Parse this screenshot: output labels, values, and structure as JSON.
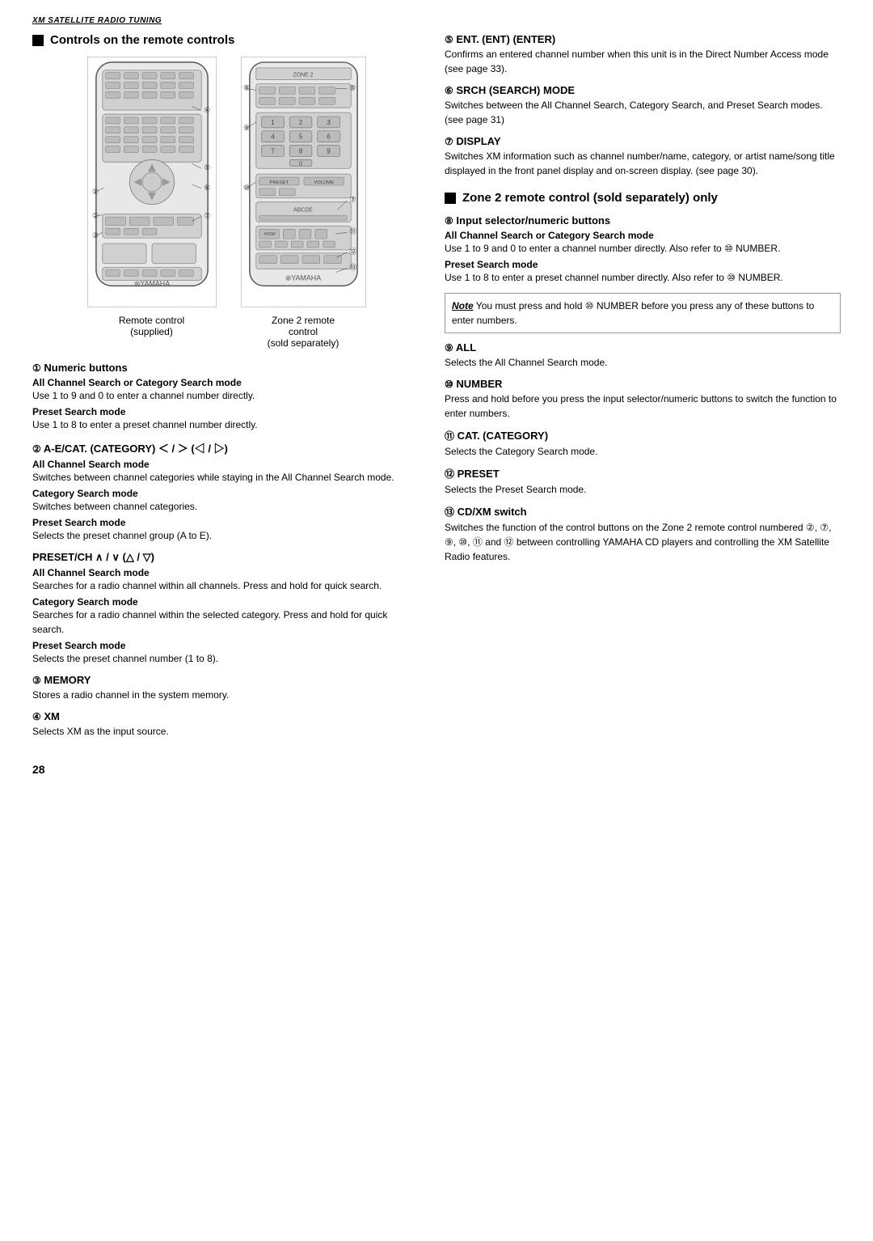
{
  "header": {
    "label": "XM SATELLITE RADIO TUNING"
  },
  "left_section": {
    "title": "Controls on the remote controls",
    "remote1_label": "Remote control\n(supplied)",
    "remote2_label": "Zone 2 remote\ncontrol\n(sold separately)",
    "items": [
      {
        "num": "①",
        "title": "Numeric buttons",
        "subs": [
          {
            "subtitle": "All Channel Search or Category Search mode",
            "text": "Use 1 to 9 and 0 to enter a channel number directly."
          },
          {
            "subtitle": "Preset Search mode",
            "text": "Use 1 to 8 to enter a preset channel number directly."
          }
        ]
      },
      {
        "num": "②",
        "title": "A-E/CAT. (CATEGORY) ＜ / ＞ (◁ / ▷)",
        "subs": [
          {
            "subtitle": "All Channel Search mode",
            "text": "Switches between channel categories while staying in the All Channel Search mode."
          },
          {
            "subtitle": "Category Search mode",
            "text": "Switches between channel categories."
          },
          {
            "subtitle": "Preset Search mode",
            "text": "Selects the preset channel group (A to E)."
          }
        ]
      },
      {
        "num": "",
        "title": "PRESET/CH ∧ / ∨ (△ / ▽)",
        "subs": [
          {
            "subtitle": "All Channel Search mode",
            "text": "Searches for a radio channel within all channels. Press and hold for quick search."
          },
          {
            "subtitle": "Category Search mode",
            "text": "Searches for a radio channel within the selected category. Press and hold for quick search."
          },
          {
            "subtitle": "Preset Search mode",
            "text": "Selects the preset channel number (1 to 8)."
          }
        ]
      },
      {
        "num": "③",
        "title": "MEMORY",
        "subs": [
          {
            "subtitle": "",
            "text": "Stores a radio channel in the system memory."
          }
        ]
      },
      {
        "num": "④",
        "title": "XM",
        "subs": [
          {
            "subtitle": "",
            "text": "Selects XM as the input source."
          }
        ]
      }
    ]
  },
  "right_section": {
    "items": [
      {
        "num": "⑤",
        "title": "ENT. (ENT) (ENTER)",
        "text": "Confirms an entered channel number when this unit is in the Direct Number Access mode (see page 33)."
      },
      {
        "num": "⑥",
        "title": "SRCH (SEARCH) MODE",
        "text": "Switches between the All Channel Search, Category Search, and Preset Search modes. (see page 31)"
      },
      {
        "num": "⑦",
        "title": "DISPLAY",
        "text": "Switches XM information such as channel number/name, category, or artist name/song title displayed in the front panel display and on-screen display. (see page 30)."
      }
    ],
    "zone2_section": {
      "title": "Zone 2 remote control (sold separately) only",
      "items": [
        {
          "num": "⑧",
          "title": "Input selector/numeric buttons",
          "subs": [
            {
              "subtitle": "All Channel Search or Category Search mode",
              "text": "Use 1 to 9 and 0 to enter a channel number directly. Also refer to ⑩ NUMBER."
            },
            {
              "subtitle": "Preset Search mode",
              "text": "Use 1 to 8 to enter a preset channel number directly. Also refer to ⑩ NUMBER."
            }
          ]
        }
      ],
      "note": {
        "label": "Note",
        "text": "You must press and hold ⑩ NUMBER before you press any of these buttons to enter numbers."
      },
      "more_items": [
        {
          "num": "⑨",
          "title": "ALL",
          "text": "Selects the All Channel Search mode."
        },
        {
          "num": "⑩",
          "title": "NUMBER",
          "text": "Press and hold before you press the input selector/numeric buttons to switch the function to enter numbers."
        },
        {
          "num": "⑪",
          "title": "CAT. (CATEGORY)",
          "text": "Selects the Category Search mode."
        },
        {
          "num": "⑫",
          "title": "PRESET",
          "text": "Selects the Preset Search mode."
        },
        {
          "num": "⑬",
          "title": "CD/XM switch",
          "text": "Switches the function of the control buttons on the Zone 2 remote control numbered ②, ⑦, ⑨, ⑩, ⑪ and ⑫ between controlling YAMAHA CD players and controlling the XM Satellite Radio features."
        }
      ]
    }
  },
  "page_number": "28"
}
